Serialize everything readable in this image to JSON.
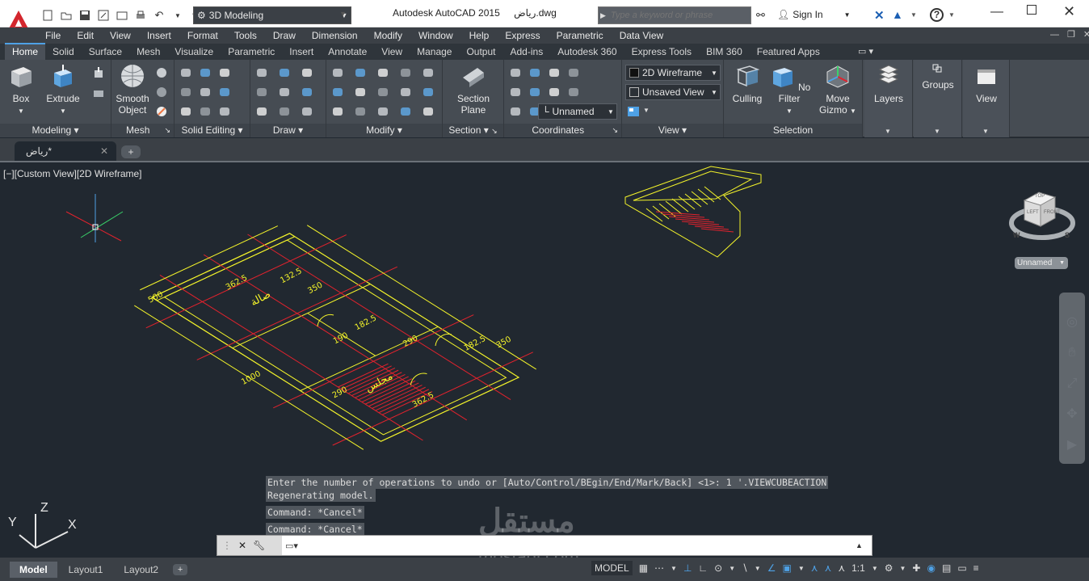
{
  "window": {
    "title": "Autodesk AutoCAD 2015",
    "document_name": "رياض.dwg",
    "workspace": "3D Modeling",
    "search_placeholder": "Type a keyword or phrase",
    "sign_in": "Sign In",
    "help_icon": "?"
  },
  "menu": [
    "File",
    "Edit",
    "View",
    "Insert",
    "Format",
    "Tools",
    "Draw",
    "Dimension",
    "Modify",
    "Window",
    "Help",
    "Express",
    "Parametric",
    "Data View"
  ],
  "ribbon_tabs": [
    "Home",
    "Solid",
    "Surface",
    "Mesh",
    "Visualize",
    "Parametric",
    "Insert",
    "Annotate",
    "View",
    "Manage",
    "Output",
    "Add-ins",
    "Autodesk 360",
    "Express Tools",
    "BIM 360",
    "Featured Apps"
  ],
  "active_ribbon_tab": "Home",
  "panels": {
    "modeling": {
      "title": "Modeling",
      "box": "Box",
      "extrude": "Extrude"
    },
    "mesh": {
      "title": "Mesh",
      "smooth_line1": "Smooth",
      "smooth_line2": "Object"
    },
    "solid_editing": {
      "title": "Solid Editing"
    },
    "draw": {
      "title": "Draw"
    },
    "modify": {
      "title": "Modify"
    },
    "section": {
      "title": "Section",
      "plane_line1": "Section",
      "plane_line2": "Plane"
    },
    "coordinates": {
      "title": "Coordinates",
      "ucs_name": "Unnamed"
    },
    "view": {
      "title": "View",
      "visual_style": "2D Wireframe",
      "saved_view": "Unsaved View"
    },
    "selection": {
      "title": "Selection",
      "culling": "Culling",
      "no_filter": "No Filter",
      "move_line1": "Move",
      "move_line2": "Gizmo"
    },
    "layers": {
      "title": "Layers"
    },
    "groups": {
      "title": "Groups"
    },
    "viewp": {
      "title": "View"
    }
  },
  "document_tab": "رياض*",
  "viewport_label": "[−][Custom View][2D Wireframe]",
  "viewcube": {
    "top": "TOP",
    "left": "LEFT",
    "front": "FRONT",
    "w": "W",
    "s": "S",
    "ucs_menu": "Unnamed"
  },
  "axis_labels": {
    "x": "X",
    "y": "Y",
    "z": "Z"
  },
  "drawing_labels": {
    "d1": "132.5",
    "d2": "362.5",
    "d3": "350",
    "d4": "182.5",
    "d5": "190",
    "d6": "182.5",
    "d7": "362.5",
    "d8": "1000",
    "d9": "500",
    "d10": "290",
    "d11": "350",
    "d12": "290",
    "room1": "صالة",
    "room2": "مجلس"
  },
  "command_history": [
    "Enter the number of operations to undo or [Auto/Control/BEgin/End/Mark/Back] <1>: 1 '.VIEWCUBEACTION",
    "Regenerating model.",
    "Command: *Cancel*",
    "Command: *Cancel*"
  ],
  "layout_tabs": [
    "Model",
    "Layout1",
    "Layout2"
  ],
  "status": {
    "model": "MODEL",
    "scale": "1:1"
  },
  "watermark": {
    "main": "مستقل",
    "sub": "mostaql.com"
  },
  "colors": {
    "accent": "#4ea1e6",
    "drawing": "#f5f52a",
    "red": "#e3222d",
    "bg": "#212830"
  }
}
